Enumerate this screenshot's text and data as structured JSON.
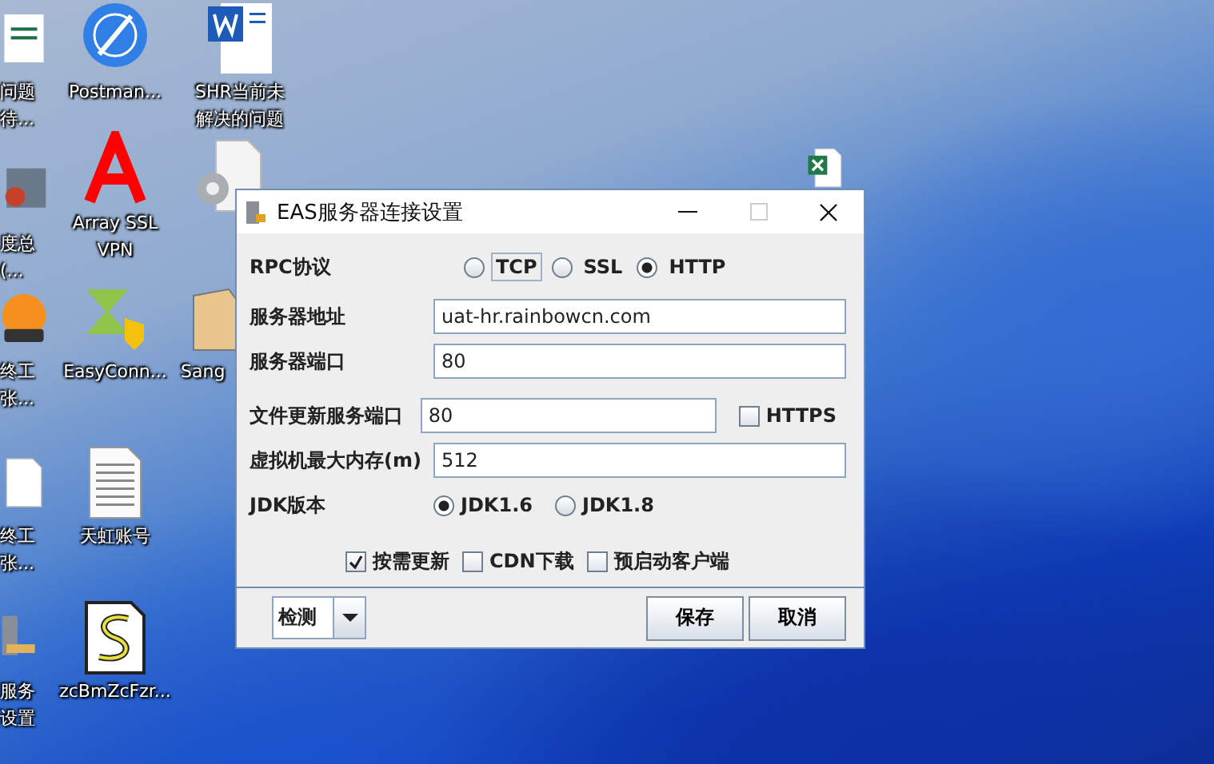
{
  "desktop_icons": [
    {
      "kind": "sheet",
      "lines": [
        "问题",
        "待..."
      ]
    },
    {
      "kind": "postman",
      "lines": [
        "Postman..."
      ]
    },
    {
      "kind": "word",
      "lines": [
        "SHR当前未",
        "解决的问题"
      ]
    },
    {
      "kind": "slides",
      "lines": [
        "度总",
        "(..."
      ]
    },
    {
      "kind": "letter-a",
      "lines": [
        "Array SSL",
        "VPN"
      ]
    },
    {
      "kind": "gear-doc"
    },
    {
      "kind": "orange",
      "lines": [
        "终工",
        "张..."
      ]
    },
    {
      "kind": "arrows",
      "lines": [
        "EasyConn..."
      ]
    },
    {
      "kind": "box",
      "lines": [
        "Sang"
      ]
    },
    {
      "kind": "blank-doc",
      "lines": [
        "终工",
        "张..."
      ]
    },
    {
      "kind": "text-doc",
      "lines": [
        "天虹账号"
      ]
    },
    {
      "kind": "server",
      "lines": [
        "服务",
        "设置"
      ]
    },
    {
      "kind": "script",
      "lines": [
        "zcBmZcFzr..."
      ]
    },
    {
      "kind": "excel"
    }
  ],
  "dialog": {
    "title": "EAS服务器连接设置",
    "rpc": {
      "label": "RPC协议",
      "options": [
        {
          "label": "TCP",
          "selected": false,
          "focused": true
        },
        {
          "label": "SSL",
          "selected": false,
          "focused": false
        },
        {
          "label": "HTTP",
          "selected": true,
          "focused": false
        }
      ]
    },
    "fields": [
      {
        "label": "服务器地址",
        "value": "uat-hr.rainbowcn.com"
      },
      {
        "label": "服务器端口",
        "value": "80"
      },
      {
        "label": "文件更新服务端口",
        "value": "80",
        "checkbox": {
          "label": "HTTPS",
          "checked": false
        }
      },
      {
        "label": "虚拟机最大内存(m)",
        "value": "512"
      }
    ],
    "jdk": {
      "label": "JDK版本",
      "options": [
        {
          "label": "JDK1.6",
          "selected": true
        },
        {
          "label": "JDK1.8",
          "selected": false
        }
      ]
    },
    "options": [
      {
        "label": "按需更新",
        "checked": true
      },
      {
        "label": "CDN下载",
        "checked": false
      },
      {
        "label": "预启动客户端",
        "checked": false
      }
    ],
    "detect": "检测",
    "buttons": [
      "保存",
      "取消"
    ]
  }
}
